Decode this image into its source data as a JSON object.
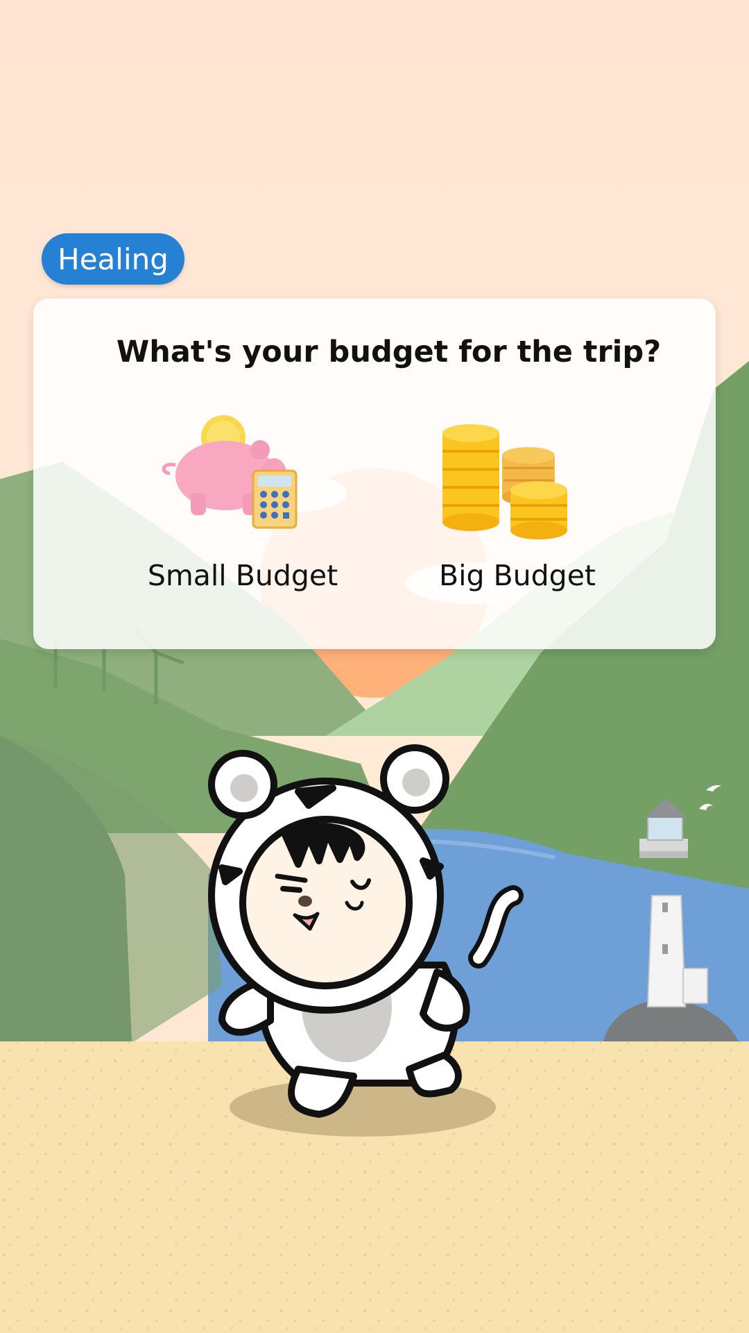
{
  "category_tag": "Healing",
  "question": "What's your budget for the trip?",
  "options": [
    {
      "label": "Small Budget",
      "icon": "piggy-bank-calculator-icon"
    },
    {
      "label": "Big Budget",
      "icon": "gold-coins-icon"
    }
  ],
  "colors": {
    "tag": "#2681d4",
    "sky_top": "#ffe4d4",
    "sun": "#ffb17a",
    "hills": "#7aa56b",
    "water": "#6e9fd6",
    "sand": "#f7e2b0"
  }
}
